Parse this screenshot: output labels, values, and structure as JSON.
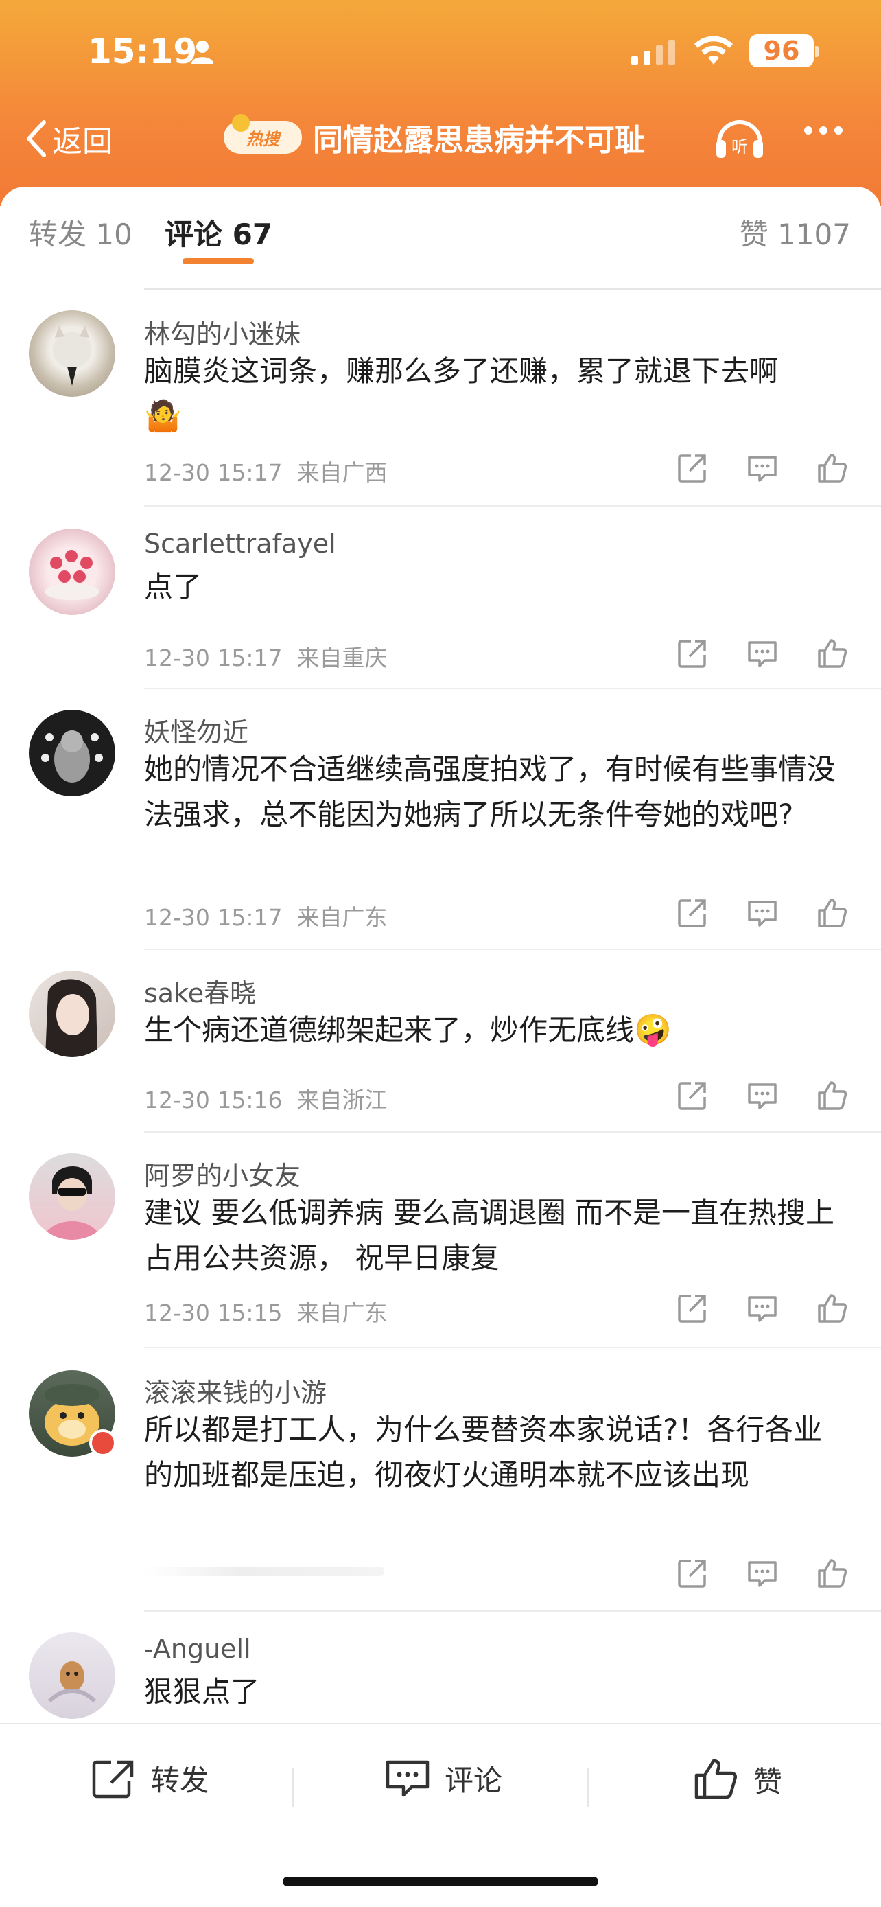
{
  "status_bar": {
    "time": "15:19",
    "battery": "96"
  },
  "nav": {
    "back_label": "返回",
    "hot_badge": "热搜",
    "title": "同情赵露思患病并不可耻",
    "listen_label": "听"
  },
  "tabs": {
    "repost": "转发 10",
    "comment": "评论 67",
    "like": "赞 1107"
  },
  "comments": [
    {
      "name": "林勾的小迷妹",
      "text": "脑膜炎这词条，赚那么多了还赚，累了就退下去啊",
      "emoji": "🤷",
      "time": "12-30 15:17",
      "location": "来自广西"
    },
    {
      "name": "Scarlettrafayel",
      "text": "点了",
      "time": "12-30 15:17",
      "location": "来自重庆"
    },
    {
      "name": "妖怪勿近",
      "text": "她的情况不合适继续高强度拍戏了，有时候有些事情没法强求，总不能因为她病了所以无条件夸她的戏吧?",
      "time": "12-30 15:17",
      "location": "来自广东"
    },
    {
      "name": "sake春晓",
      "text": "生个病还道德绑架起来了，炒作无底线",
      "emoji": "🤪",
      "time": "12-30 15:16",
      "location": "来自浙江"
    },
    {
      "name": "阿罗的小女友",
      "text": "建议 要么低调养病 要么高调退圈 而不是一直在热搜上占用公共资源， 祝早日康复",
      "time": "12-30 15:15",
      "location": "来自广东"
    },
    {
      "name": "滚滚来钱的小游",
      "text": "所以都是打工人，为什么要替资本家说话?！各行各业的加班都是压迫，彻夜灯火通明本就不应该出现"
    },
    {
      "name": "-Anguell",
      "text": "狠狠点了"
    }
  ],
  "bottom_bar": {
    "repost": "转发",
    "comment": "评论",
    "like": "赞"
  },
  "colors": {
    "header_orange": "#f4863a",
    "accent": "#f2822f"
  }
}
